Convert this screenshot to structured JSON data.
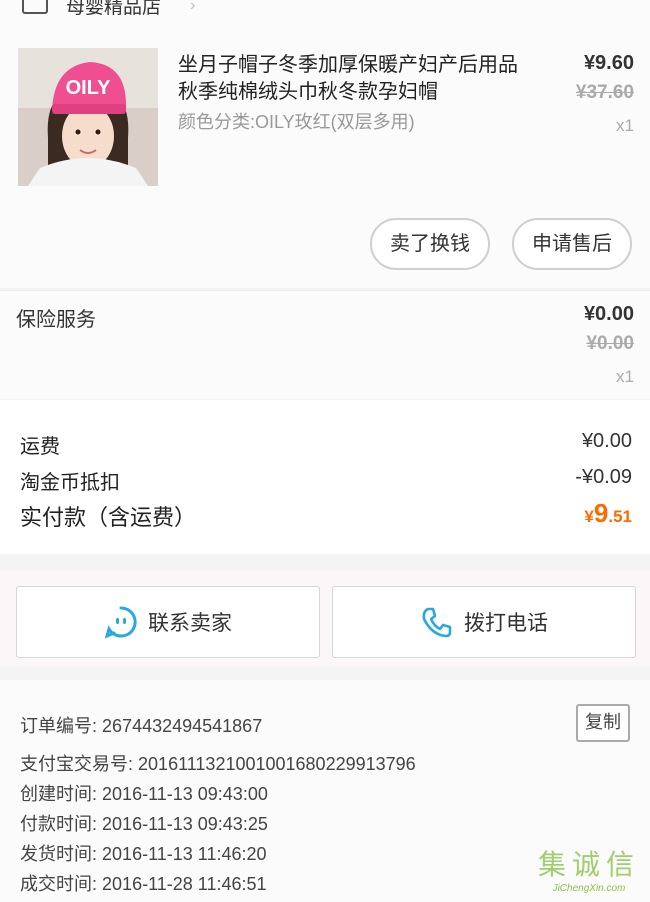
{
  "store": {
    "name": "母婴精品店"
  },
  "product": {
    "title": "坐月子帽子冬季加厚保暖产妇产后用品秋季纯棉绒头巾秋冬款孕妇帽",
    "variant": "颜色分类:OILY玫红(双层多用)",
    "price": "¥9.60",
    "original_price": "¥37.60",
    "quantity": "x1",
    "hat_text": "OILY"
  },
  "actions": {
    "sell_label": "卖了换钱",
    "after_sale_label": "申请售后"
  },
  "insurance": {
    "label": "保险服务",
    "price": "¥0.00",
    "original_price": "¥0.00",
    "quantity": "x1"
  },
  "summary": {
    "shipping_label": "运费",
    "shipping_value": "¥0.00",
    "coins_label": "淘金币抵扣",
    "coins_value": "-¥0.09",
    "total_label": "实付款（含运费）",
    "total_symbol": "¥",
    "total_int": "9",
    "total_dec": ".51"
  },
  "contact": {
    "seller_label": "联系卖家",
    "call_label": "拨打电话"
  },
  "order": {
    "number_label": "订单编号:",
    "number": "2674432494541867",
    "alipay_label": "支付宝交易号:",
    "alipay": "2016111321001001680229913796",
    "created_label": "创建时间:",
    "created": "2016-11-13 09:43:00",
    "paid_label": "付款时间:",
    "paid": "2016-11-13 09:43:25",
    "shipped_label": "发货时间:",
    "shipped": "2016-11-13 11:46:20",
    "closed_label": "成交时间:",
    "closed": "2016-11-28 11:46:51",
    "copy_label": "复制"
  },
  "watermark": {
    "logo": "集诚信",
    "site": "JiChengXin.com"
  },
  "colors": {
    "accent": "#ff6a00",
    "icon_blue": "#29a8e0",
    "hat_pink": "#ef4f91"
  }
}
